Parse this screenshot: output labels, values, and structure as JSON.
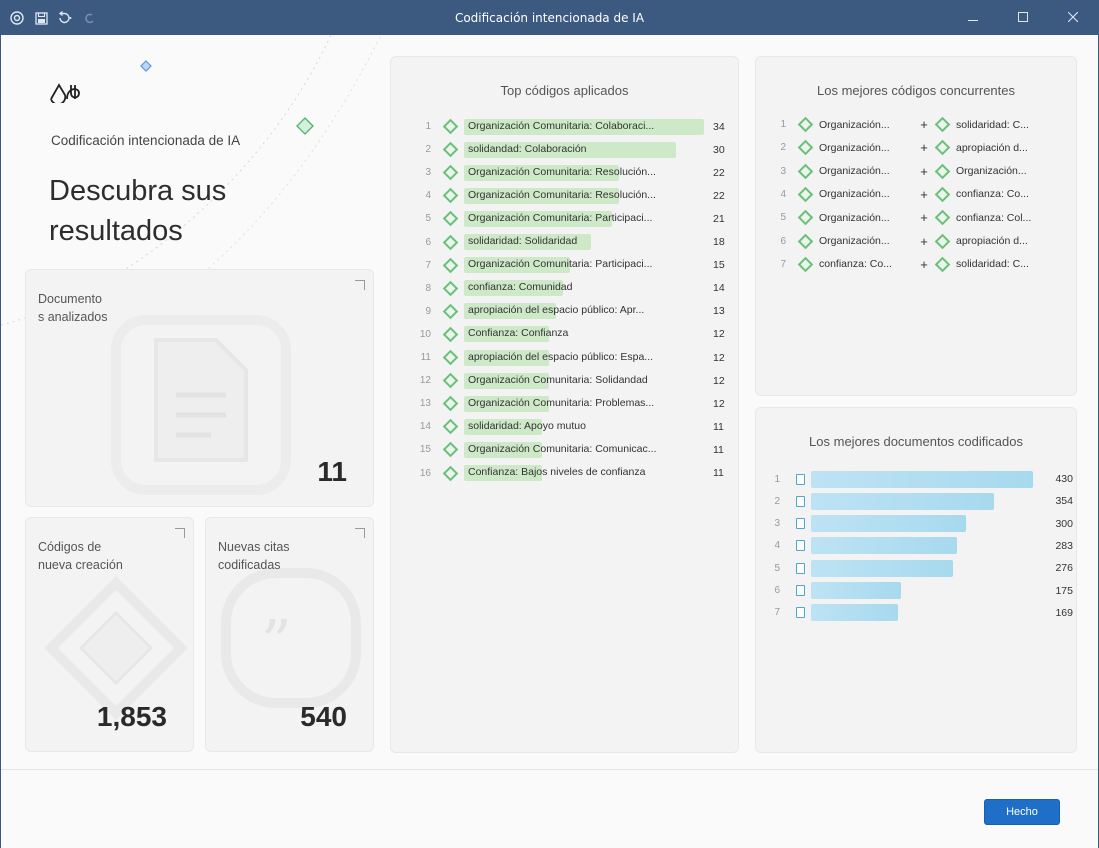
{
  "titlebar": {
    "title": "Codificación intencionada de IA",
    "icons": [
      "app-icon",
      "save-icon",
      "undo-icon",
      "redo-icon"
    ],
    "controls": [
      "minimize-icon",
      "maximize-icon",
      "close-icon"
    ]
  },
  "hero": {
    "subtitle": "Codificación intencionada de IA",
    "title_line1": "Descubra sus",
    "title_line2": "resultados"
  },
  "cards": {
    "documents": {
      "label_line1": "Documento",
      "label_line2": "s analizados",
      "value": "11"
    },
    "new_codes": {
      "label_line1": "Códigos de",
      "label_line2": "nueva creación",
      "value": "1,853"
    },
    "new_quotes": {
      "label_line1": "Nuevas citas",
      "label_line2": "codificadas",
      "value": "540"
    }
  },
  "top_codes": {
    "title": "Top códigos aplicados",
    "rows": [
      {
        "rank": "1",
        "label": "Organización Comunitaria: Colaboraci...",
        "count": 34
      },
      {
        "rank": "2",
        "label": "solidandad: Colaboración",
        "count": 30
      },
      {
        "rank": "3",
        "label": "Organización Comunitaria: Resolución...",
        "count": 22
      },
      {
        "rank": "4",
        "label": "Organización Comunitaria: Resolución...",
        "count": 22
      },
      {
        "rank": "5",
        "label": "Organización Comunitaria: Participaci...",
        "count": 21
      },
      {
        "rank": "6",
        "label": "solidaridad: Solidaridad",
        "count": 18
      },
      {
        "rank": "7",
        "label": "Organización Comunitaria: Participaci...",
        "count": 15
      },
      {
        "rank": "8",
        "label": "confianza: Comunidad",
        "count": 14
      },
      {
        "rank": "9",
        "label": "apropiación del espacio público: Apr...",
        "count": 13
      },
      {
        "rank": "10",
        "label": "Confianza: Confianza",
        "count": 12
      },
      {
        "rank": "11",
        "label": "apropiación del espacio público: Espa...",
        "count": 12
      },
      {
        "rank": "12",
        "label": "Organización Comunitaria: Solidandad",
        "count": 12
      },
      {
        "rank": "13",
        "label": "Organización Comunitaria: Problemas...",
        "count": 12
      },
      {
        "rank": "14",
        "label": "solidaridad: Apoyo mutuo",
        "count": 11
      },
      {
        "rank": "15",
        "label": "Organización Comunitaria: Comunicac...",
        "count": 11
      },
      {
        "rank": "16",
        "label": "Confianza: Bajos niveles de confianza",
        "count": 11
      }
    ]
  },
  "co_codes": {
    "title": "Los mejores códigos concurrentes",
    "rows": [
      {
        "rank": "1",
        "a": "Organización...",
        "b": "solidaridad: C..."
      },
      {
        "rank": "2",
        "a": "Organización...",
        "b": "apropiación d..."
      },
      {
        "rank": "3",
        "a": "Organización...",
        "b": "Organización..."
      },
      {
        "rank": "4",
        "a": "Organización...",
        "b": "confianza: Co..."
      },
      {
        "rank": "5",
        "a": "Organización...",
        "b": "confianza: Col..."
      },
      {
        "rank": "6",
        "a": "Organización...",
        "b": "apropiación d..."
      },
      {
        "rank": "7",
        "a": "confianza: Co...",
        "b": "solidaridad: C..."
      }
    ]
  },
  "top_docs": {
    "title": "Los mejores documentos codificados",
    "rows": [
      {
        "rank": "1",
        "count": 430
      },
      {
        "rank": "2",
        "count": 354
      },
      {
        "rank": "3",
        "count": 300
      },
      {
        "rank": "4",
        "count": 283
      },
      {
        "rank": "5",
        "count": 276
      },
      {
        "rank": "6",
        "count": 175
      },
      {
        "rank": "7",
        "count": 169
      }
    ]
  },
  "footer": {
    "done_label": "Hecho"
  },
  "colors": {
    "titlebar": "#3c5a80",
    "accent": "#1f6fc8",
    "code_bar": "#cde9c7",
    "doc_bar": "#a7d9ee",
    "gem": "#6bbf7a"
  }
}
